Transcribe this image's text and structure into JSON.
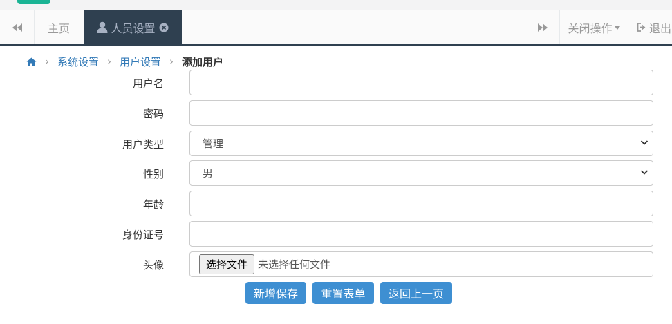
{
  "tabbar": {
    "home_tab": "主页",
    "active_tab": "人员设置",
    "close_ops": "关闭操作",
    "logout": "退出"
  },
  "breadcrumb": {
    "items": [
      "系统设置",
      "用户设置"
    ],
    "current": "添加用户"
  },
  "form": {
    "username_label": "用户名",
    "username_value": "",
    "password_label": "密码",
    "password_value": "",
    "usertype_label": "用户类型",
    "usertype_selected": "管理",
    "gender_label": "性别",
    "gender_selected": "男",
    "age_label": "年龄",
    "age_value": "",
    "idcard_label": "身份证号",
    "idcard_value": "",
    "avatar_label": "头像",
    "file_button": "选择文件",
    "file_status": "未选择任何文件"
  },
  "buttons": {
    "save": "新增保存",
    "reset": "重置表单",
    "back": "返回上一页"
  },
  "colors": {
    "tab_active_bg": "#2f4050",
    "button_bg": "#3e8fd2",
    "link": "#337ab7",
    "brand": "#1ab394"
  }
}
